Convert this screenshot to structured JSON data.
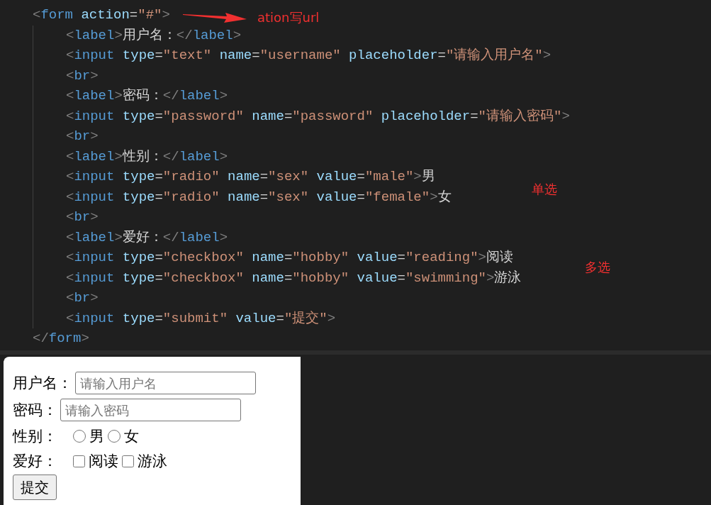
{
  "code": [
    {
      "tokens": [
        {
          "kind": "punct",
          "text": "<"
        },
        {
          "kind": "tag",
          "text": "form"
        },
        {
          "kind": "attr",
          "text": " action"
        },
        {
          "kind": "eq",
          "text": "="
        },
        {
          "kind": "str",
          "text": "\"#\""
        },
        {
          "kind": "punct",
          "text": ">"
        }
      ],
      "children": [
        {
          "tokens": [
            {
              "kind": "punct",
              "text": "<"
            },
            {
              "kind": "tag",
              "text": "label"
            },
            {
              "kind": "punct",
              "text": ">"
            },
            {
              "kind": "text",
              "text": "用户名："
            },
            {
              "kind": "punct",
              "text": "</"
            },
            {
              "kind": "tag",
              "text": "label"
            },
            {
              "kind": "punct",
              "text": ">"
            }
          ]
        },
        {
          "tokens": [
            {
              "kind": "punct",
              "text": "<"
            },
            {
              "kind": "tag",
              "text": "input"
            },
            {
              "kind": "attr",
              "text": " type"
            },
            {
              "kind": "eq",
              "text": "="
            },
            {
              "kind": "str",
              "text": "\"text\""
            },
            {
              "kind": "attr",
              "text": " name"
            },
            {
              "kind": "eq",
              "text": "="
            },
            {
              "kind": "str",
              "text": "\"username\""
            },
            {
              "kind": "attr",
              "text": " placeholder"
            },
            {
              "kind": "eq",
              "text": "="
            },
            {
              "kind": "str",
              "text": "\"请输入用户名\""
            },
            {
              "kind": "punct",
              "text": ">"
            }
          ]
        },
        {
          "tokens": [
            {
              "kind": "punct",
              "text": "<"
            },
            {
              "kind": "tag",
              "text": "br"
            },
            {
              "kind": "punct",
              "text": ">"
            }
          ]
        },
        {
          "tokens": [
            {
              "kind": "punct",
              "text": "<"
            },
            {
              "kind": "tag",
              "text": "label"
            },
            {
              "kind": "punct",
              "text": ">"
            },
            {
              "kind": "text",
              "text": "密码："
            },
            {
              "kind": "punct",
              "text": "</"
            },
            {
              "kind": "tag",
              "text": "label"
            },
            {
              "kind": "punct",
              "text": ">"
            }
          ]
        },
        {
          "tokens": [
            {
              "kind": "punct",
              "text": "<"
            },
            {
              "kind": "tag",
              "text": "input"
            },
            {
              "kind": "attr",
              "text": " type"
            },
            {
              "kind": "eq",
              "text": "="
            },
            {
              "kind": "str",
              "text": "\"password\""
            },
            {
              "kind": "attr",
              "text": " name"
            },
            {
              "kind": "eq",
              "text": "="
            },
            {
              "kind": "str",
              "text": "\"password\""
            },
            {
              "kind": "attr",
              "text": " placeholder"
            },
            {
              "kind": "eq",
              "text": "="
            },
            {
              "kind": "str",
              "text": "\"请输入密码\""
            },
            {
              "kind": "punct",
              "text": ">"
            }
          ]
        },
        {
          "tokens": [
            {
              "kind": "punct",
              "text": "<"
            },
            {
              "kind": "tag",
              "text": "br"
            },
            {
              "kind": "punct",
              "text": ">"
            }
          ]
        },
        {
          "tokens": [
            {
              "kind": "punct",
              "text": "<"
            },
            {
              "kind": "tag",
              "text": "label"
            },
            {
              "kind": "punct",
              "text": ">"
            },
            {
              "kind": "text",
              "text": "性别："
            },
            {
              "kind": "punct",
              "text": "</"
            },
            {
              "kind": "tag",
              "text": "label"
            },
            {
              "kind": "punct",
              "text": ">"
            }
          ]
        },
        {
          "tokens": [
            {
              "kind": "punct",
              "text": "<"
            },
            {
              "kind": "tag",
              "text": "input"
            },
            {
              "kind": "attr",
              "text": " type"
            },
            {
              "kind": "eq",
              "text": "="
            },
            {
              "kind": "str",
              "text": "\"radio\""
            },
            {
              "kind": "attr",
              "text": " name"
            },
            {
              "kind": "eq",
              "text": "="
            },
            {
              "kind": "str",
              "text": "\"sex\""
            },
            {
              "kind": "attr",
              "text": " value"
            },
            {
              "kind": "eq",
              "text": "="
            },
            {
              "kind": "str",
              "text": "\"male\""
            },
            {
              "kind": "punct",
              "text": ">"
            },
            {
              "kind": "text",
              "text": "男"
            }
          ]
        },
        {
          "tokens": [
            {
              "kind": "punct",
              "text": "<"
            },
            {
              "kind": "tag",
              "text": "input"
            },
            {
              "kind": "attr",
              "text": " type"
            },
            {
              "kind": "eq",
              "text": "="
            },
            {
              "kind": "str",
              "text": "\"radio\""
            },
            {
              "kind": "attr",
              "text": " name"
            },
            {
              "kind": "eq",
              "text": "="
            },
            {
              "kind": "str",
              "text": "\"sex\""
            },
            {
              "kind": "attr",
              "text": " value"
            },
            {
              "kind": "eq",
              "text": "="
            },
            {
              "kind": "str",
              "text": "\"female\""
            },
            {
              "kind": "punct",
              "text": ">"
            },
            {
              "kind": "text",
              "text": "女"
            }
          ]
        },
        {
          "tokens": [
            {
              "kind": "punct",
              "text": "<"
            },
            {
              "kind": "tag",
              "text": "br"
            },
            {
              "kind": "punct",
              "text": ">"
            }
          ]
        },
        {
          "tokens": [
            {
              "kind": "punct",
              "text": "<"
            },
            {
              "kind": "tag",
              "text": "label"
            },
            {
              "kind": "punct",
              "text": ">"
            },
            {
              "kind": "text",
              "text": "爱好："
            },
            {
              "kind": "punct",
              "text": "</"
            },
            {
              "kind": "tag",
              "text": "label"
            },
            {
              "kind": "punct",
              "text": ">"
            }
          ]
        },
        {
          "tokens": [
            {
              "kind": "punct",
              "text": "<"
            },
            {
              "kind": "tag",
              "text": "input"
            },
            {
              "kind": "attr",
              "text": " type"
            },
            {
              "kind": "eq",
              "text": "="
            },
            {
              "kind": "str",
              "text": "\"checkbox\""
            },
            {
              "kind": "attr",
              "text": " name"
            },
            {
              "kind": "eq",
              "text": "="
            },
            {
              "kind": "str",
              "text": "\"hobby\""
            },
            {
              "kind": "attr",
              "text": " value"
            },
            {
              "kind": "eq",
              "text": "="
            },
            {
              "kind": "str",
              "text": "\"reading\""
            },
            {
              "kind": "punct",
              "text": ">"
            },
            {
              "kind": "text",
              "text": "阅读"
            }
          ]
        },
        {
          "tokens": [
            {
              "kind": "punct",
              "text": "<"
            },
            {
              "kind": "tag",
              "text": "input"
            },
            {
              "kind": "attr",
              "text": " type"
            },
            {
              "kind": "eq",
              "text": "="
            },
            {
              "kind": "str",
              "text": "\"checkbox\""
            },
            {
              "kind": "attr",
              "text": " name"
            },
            {
              "kind": "eq",
              "text": "="
            },
            {
              "kind": "str",
              "text": "\"hobby\""
            },
            {
              "kind": "attr",
              "text": " value"
            },
            {
              "kind": "eq",
              "text": "="
            },
            {
              "kind": "str",
              "text": "\"swimming\""
            },
            {
              "kind": "punct",
              "text": ">"
            },
            {
              "kind": "text",
              "text": "游泳"
            }
          ]
        },
        {
          "tokens": [
            {
              "kind": "punct",
              "text": "<"
            },
            {
              "kind": "tag",
              "text": "br"
            },
            {
              "kind": "punct",
              "text": ">"
            }
          ]
        },
        {
          "tokens": [
            {
              "kind": "punct",
              "text": "<"
            },
            {
              "kind": "tag",
              "text": "input"
            },
            {
              "kind": "attr",
              "text": " type"
            },
            {
              "kind": "eq",
              "text": "="
            },
            {
              "kind": "str",
              "text": "\"submit\""
            },
            {
              "kind": "attr",
              "text": " value"
            },
            {
              "kind": "eq",
              "text": "="
            },
            {
              "kind": "str",
              "text": "\"提交\""
            },
            {
              "kind": "punct",
              "text": ">"
            }
          ]
        }
      ]
    },
    {
      "tokens": [
        {
          "kind": "punct",
          "text": "</"
        },
        {
          "kind": "tag",
          "text": "form"
        },
        {
          "kind": "punct",
          "text": ">"
        }
      ]
    }
  ],
  "annotations": [
    {
      "text": "ation写url",
      "arrow": true
    },
    {
      "text": "单选",
      "arrow": false
    },
    {
      "text": "多选",
      "arrow": false
    }
  ],
  "preview": {
    "fields": [
      {
        "kind": "text",
        "label": "用户名：",
        "placeholder": "请输入用户名"
      },
      {
        "kind": "password",
        "label": "密码：",
        "placeholder": "请输入密码"
      },
      {
        "kind": "radio",
        "label": "性别：",
        "options": [
          {
            "label": "男",
            "checked": false
          },
          {
            "label": "女",
            "checked": false
          }
        ]
      },
      {
        "kind": "checkbox",
        "label": "爱好：",
        "options": [
          {
            "label": "阅读",
            "checked": false
          },
          {
            "label": "游泳",
            "checked": false
          }
        ]
      }
    ],
    "submit": "提交"
  }
}
